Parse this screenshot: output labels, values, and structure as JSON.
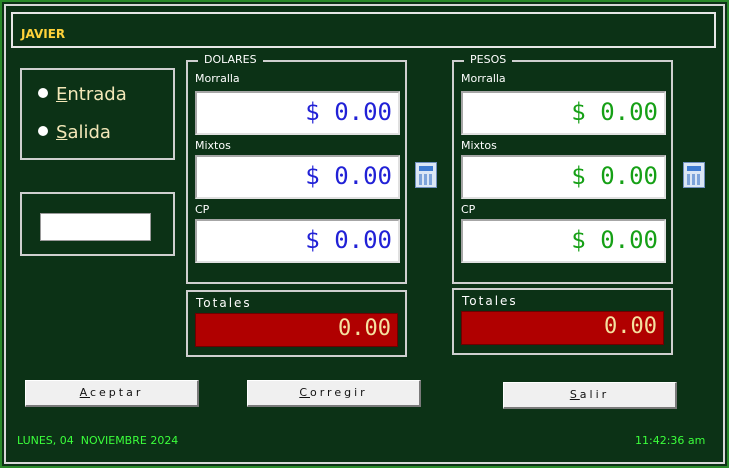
{
  "title": "JAVIER",
  "mode": {
    "entrada_first": "E",
    "entrada_rest": "ntrada",
    "salida_first": "S",
    "salida_rest": "alida"
  },
  "dolares": {
    "title": "DOLARES",
    "morralla_label": "Morralla",
    "morralla_value": "$ 0.00",
    "mixtos_label": "Mixtos",
    "mixtos_value": "$ 0.00",
    "cp_label": "CP",
    "cp_value": "$ 0.00",
    "totales_label": "Totales",
    "totales_value": "0.00"
  },
  "pesos": {
    "title": "PESOS",
    "morralla_label": "Morralla",
    "morralla_value": "$ 0.00",
    "mixtos_label": "Mixtos",
    "mixtos_value": "$ 0.00",
    "cp_label": "CP",
    "cp_value": "$ 0.00",
    "totales_label": "Totales",
    "totales_value": "0.00"
  },
  "buttons": {
    "aceptar_first": "A",
    "aceptar_rest": "ceptar",
    "corregir_first": "C",
    "corregir_rest": "orregir",
    "salir_first": "S",
    "salir_rest": "alir"
  },
  "status": {
    "date": "LUNES, 04  NOVIEMBRE 2024",
    "time": "11:42:36 am"
  },
  "icons": {
    "calculator": "calculator-icon",
    "radio": "radio-icon"
  },
  "colors": {
    "background": "#0c3216",
    "title_text": "#ffd23a",
    "usd_text": "#2121d6",
    "mxn_text": "#16a016",
    "total_bg": "#b00000",
    "status_text": "#3bff3b"
  }
}
